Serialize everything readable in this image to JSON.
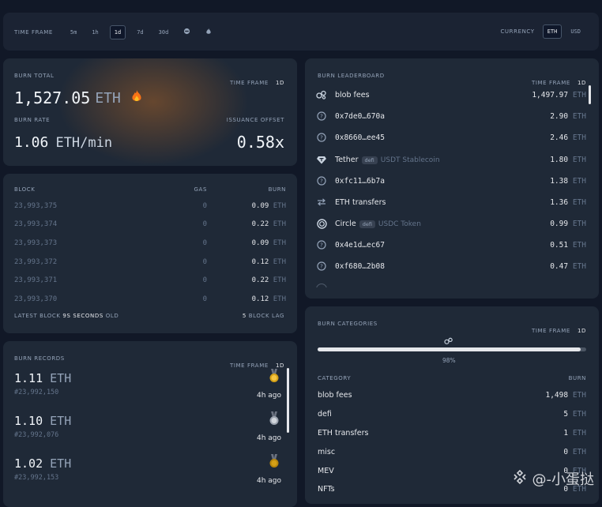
{
  "topbar": {
    "timeframe_label": "TIME FRAME",
    "options": [
      "5m",
      "1h",
      "1d",
      "7d",
      "30d"
    ],
    "active": "1d",
    "extra_icons": [
      "merge-icon",
      "flame-icon"
    ],
    "currency_label": "CURRENCY",
    "currency_options": [
      "ETH",
      "USD"
    ],
    "currency_active": "ETH"
  },
  "burn_total": {
    "label": "BURN TOTAL",
    "tf_label": "TIME FRAME",
    "tf_value": "1d",
    "value": "1,527.05",
    "unit": "ETH",
    "rate_label": "BURN RATE",
    "rate_value": "1.06",
    "rate_unit": "ETH/min",
    "offset_label": "ISSUANCE OFFSET",
    "offset_value": "0.58x"
  },
  "blocks": {
    "headers": {
      "block": "BLOCK",
      "gas": "GAS",
      "burn": "BURN"
    },
    "rows": [
      {
        "block": "23,993,375",
        "gas": "0",
        "burn": "0.09",
        "unit": "ETH"
      },
      {
        "block": "23,993,374",
        "gas": "0",
        "burn": "0.22",
        "unit": "ETH"
      },
      {
        "block": "23,993,373",
        "gas": "0",
        "burn": "0.09",
        "unit": "ETH"
      },
      {
        "block": "23,993,372",
        "gas": "0",
        "burn": "0.12",
        "unit": "ETH"
      },
      {
        "block": "23,993,371",
        "gas": "0",
        "burn": "0.22",
        "unit": "ETH"
      },
      {
        "block": "23,993,370",
        "gas": "0",
        "burn": "0.12",
        "unit": "ETH"
      }
    ],
    "footer_left_prefix": "LATEST BLOCK",
    "footer_left_value": "9s",
    "footer_left_strong": "SECONDS",
    "footer_left_suffix": "OLD",
    "footer_right_value": "5",
    "footer_right_label": "BLOCK LAG"
  },
  "records": {
    "label": "BURN RECORDS",
    "tf_label": "TIME FRAME",
    "tf_value": "1d",
    "items": [
      {
        "value": "1.11",
        "unit": "ETH",
        "block": "#23,992,150",
        "ago": "4h ago",
        "medal": "gold"
      },
      {
        "value": "1.10",
        "unit": "ETH",
        "block": "#23,992,076",
        "ago": "4h ago",
        "medal": "silver"
      },
      {
        "value": "1.02",
        "unit": "ETH",
        "block": "#23,992,153",
        "ago": "4h ago",
        "medal": "gold"
      }
    ]
  },
  "leaderboard": {
    "label": "BURN LEADERBOARD",
    "tf_label": "TIME FRAME",
    "tf_value": "1d",
    "rows": [
      {
        "name": "blob fees",
        "tag": "",
        "sub": "",
        "value": "1,497.97",
        "unit": "ETH",
        "icon": "blob-icon",
        "mono": false
      },
      {
        "name": "0x7de0…670a",
        "tag": "",
        "sub": "",
        "value": "2.90",
        "unit": "ETH",
        "icon": "question-icon",
        "mono": true
      },
      {
        "name": "0x8660…ee45",
        "tag": "",
        "sub": "",
        "value": "2.46",
        "unit": "ETH",
        "icon": "question-icon",
        "mono": true
      },
      {
        "name": "Tether",
        "tag": "defi",
        "sub": "USDT Stablecoin",
        "value": "1.80",
        "unit": "ETH",
        "icon": "tether-icon",
        "mono": false
      },
      {
        "name": "0xfc11…6b7a",
        "tag": "",
        "sub": "",
        "value": "1.38",
        "unit": "ETH",
        "icon": "question-icon",
        "mono": true
      },
      {
        "name": "ETH transfers",
        "tag": "",
        "sub": "",
        "value": "1.36",
        "unit": "ETH",
        "icon": "transfer-icon",
        "mono": false
      },
      {
        "name": "Circle",
        "tag": "defi",
        "sub": "USDC Token",
        "value": "0.99",
        "unit": "ETH",
        "icon": "circle-icon",
        "mono": false
      },
      {
        "name": "0x4e1d…ec67",
        "tag": "",
        "sub": "",
        "value": "0.51",
        "unit": "ETH",
        "icon": "question-icon",
        "mono": true
      },
      {
        "name": "0xf680…2b08",
        "tag": "",
        "sub": "",
        "value": "0.47",
        "unit": "ETH",
        "icon": "question-icon",
        "mono": true
      }
    ]
  },
  "categories": {
    "label": "BURN CATEGORIES",
    "tf_label": "TIME FRAME",
    "tf_value": "1d",
    "bar_fraction": 0.98,
    "bar_percent": "98%",
    "col_category": "CATEGORY",
    "col_burn": "BURN",
    "rows": [
      {
        "name": "blob fees",
        "value": "1,498",
        "unit": "ETH"
      },
      {
        "name": "defi",
        "value": "5",
        "unit": "ETH"
      },
      {
        "name": "ETH transfers",
        "value": "1",
        "unit": "ETH"
      },
      {
        "name": "misc",
        "value": "0",
        "unit": "ETH"
      },
      {
        "name": "MEV",
        "value": "0",
        "unit": "ETH"
      },
      {
        "name": "NFTs",
        "value": "0",
        "unit": "ETH"
      }
    ]
  },
  "watermark": {
    "text": "@-小蛋挞"
  }
}
